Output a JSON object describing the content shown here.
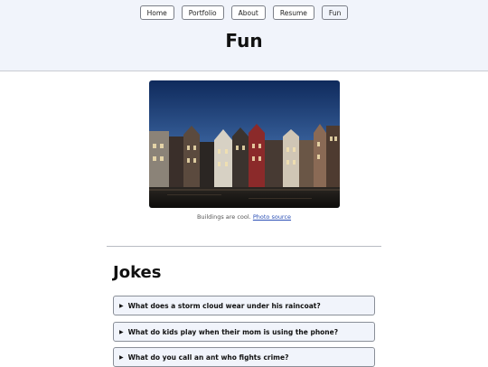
{
  "nav": {
    "items": [
      {
        "label": "Home"
      },
      {
        "label": "Portfolio"
      },
      {
        "label": "About"
      },
      {
        "label": "Resume"
      },
      {
        "label": "Fun"
      }
    ]
  },
  "header": {
    "title": "Fun"
  },
  "figure": {
    "caption_text": "Buildings are cool.",
    "caption_link": "Photo source"
  },
  "jokes": {
    "heading": "Jokes",
    "items": [
      {
        "question": "What does a storm cloud wear under his raincoat?"
      },
      {
        "question": "What do kids play when their mom is using the phone?"
      },
      {
        "question": "What do you call an ant who fights crime?"
      }
    ]
  },
  "colors": {
    "header_bg": "#f1f4fb",
    "link": "#2a4fb5"
  }
}
